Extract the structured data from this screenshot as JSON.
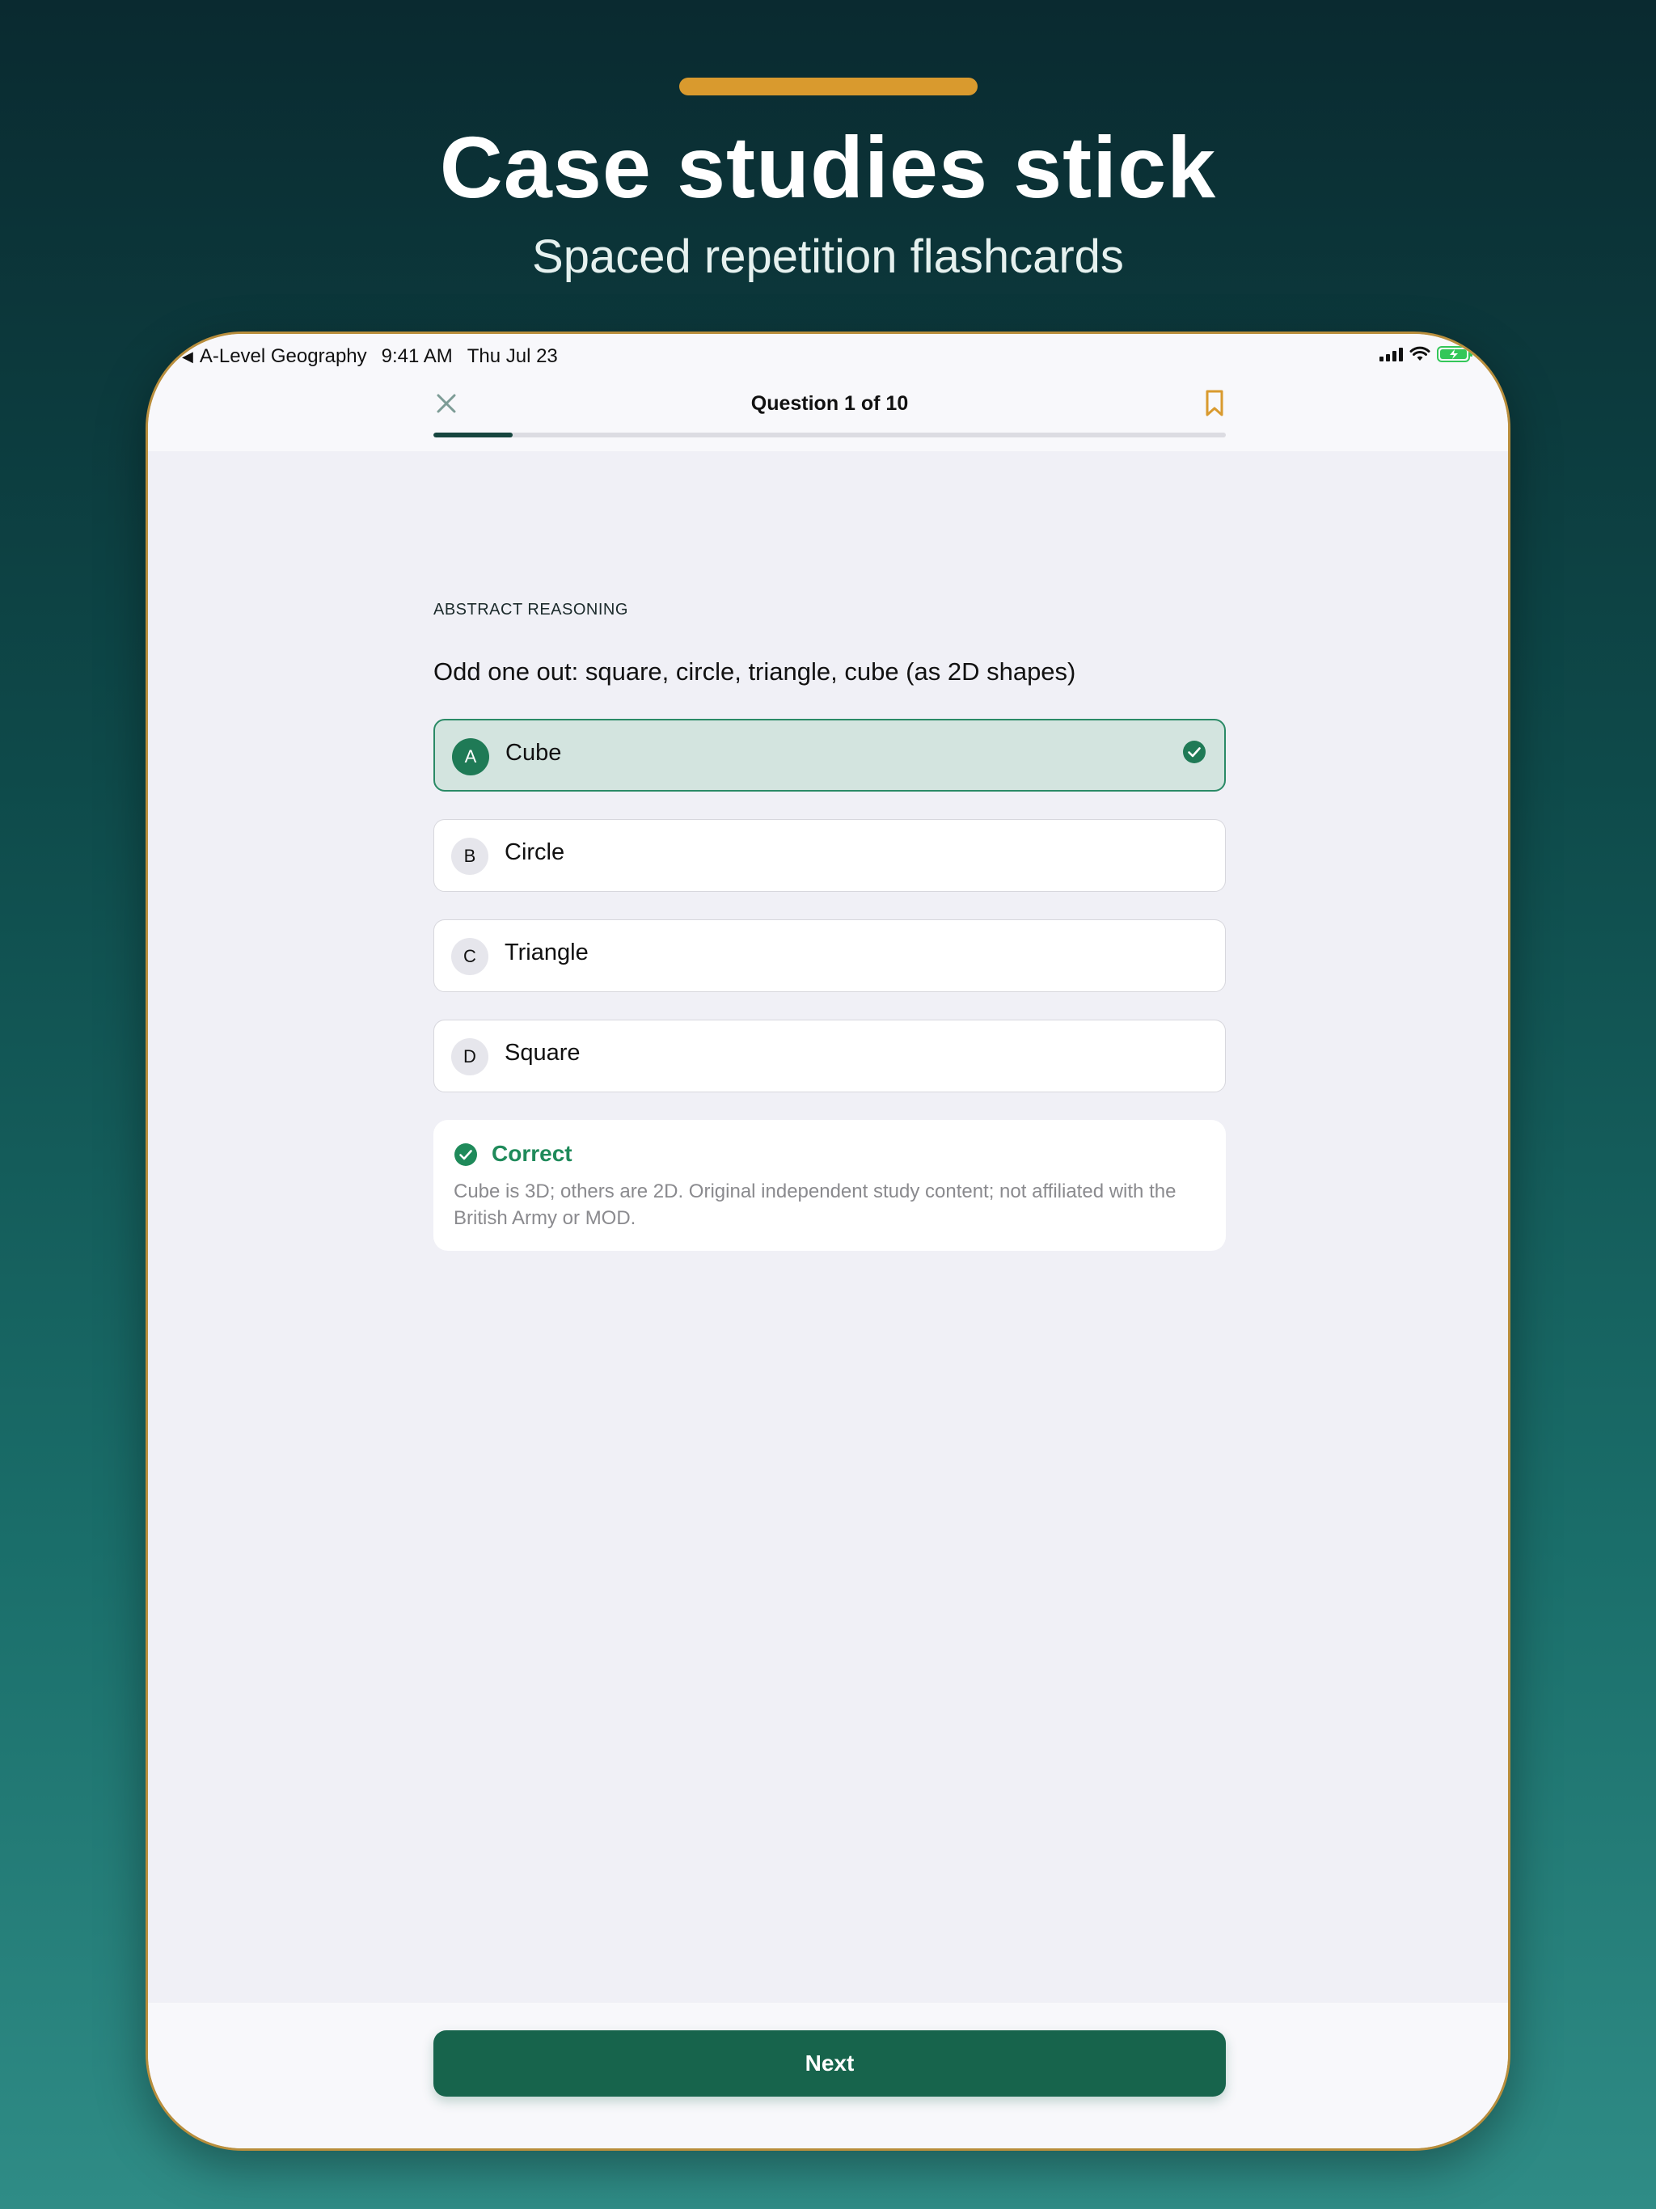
{
  "marketing": {
    "headline": "Case studies stick",
    "subheadline": "Spaced repetition flashcards"
  },
  "status_bar": {
    "back_app": "A-Level Geography",
    "time": "9:41 AM",
    "date": "Thu Jul 23"
  },
  "header": {
    "question_counter": "Question 1 of 10",
    "progress_fraction": 0.1,
    "close_icon": "close-icon",
    "bookmark_icon": "bookmark-icon"
  },
  "question": {
    "category": "ABSTRACT REASONING",
    "text": "Odd one out: square, circle, triangle, cube (as 2D shapes)"
  },
  "options": [
    {
      "letter": "A",
      "label": "Cube",
      "selected": true
    },
    {
      "letter": "B",
      "label": "Circle",
      "selected": false
    },
    {
      "letter": "C",
      "label": "Triangle",
      "selected": false
    },
    {
      "letter": "D",
      "label": "Square",
      "selected": false
    }
  ],
  "feedback": {
    "title": "Correct",
    "text": "Cube is 3D; others are 2D. Original independent study content; not affiliated with the British Army or MOD."
  },
  "footer": {
    "next_label": "Next"
  },
  "colors": {
    "accent": "#d99a2e",
    "primary": "#17644c",
    "correct": "#1f8a5a",
    "selected_bg": "#d3e4df"
  }
}
